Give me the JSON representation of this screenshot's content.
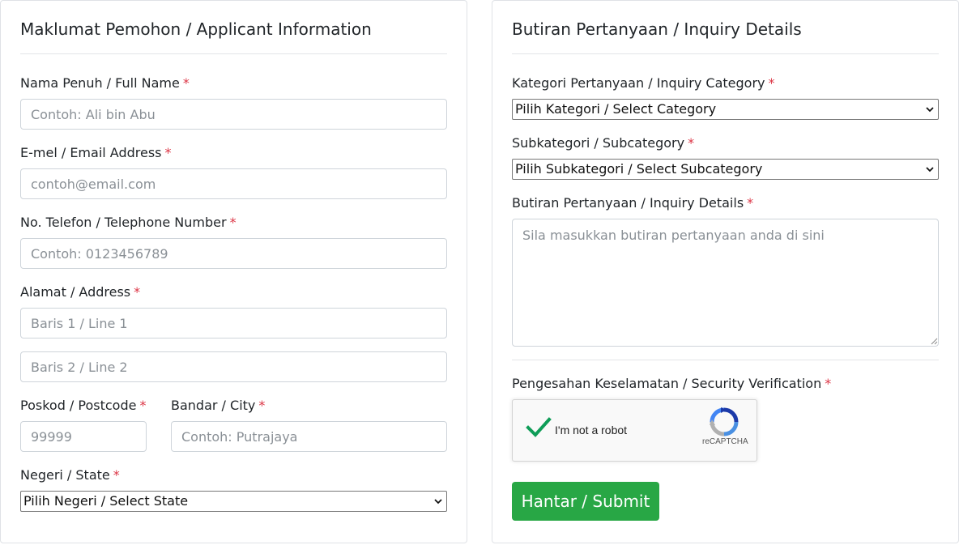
{
  "applicant": {
    "title": "Maklumat Pemohon / Applicant Information",
    "fullname": {
      "label": "Nama Penuh / Full Name",
      "required": "*",
      "placeholder": "Contoh: Ali bin Abu"
    },
    "email": {
      "label": "E-mel / Email Address",
      "required": "*",
      "placeholder": "contoh@email.com"
    },
    "phone": {
      "label": "No. Telefon / Telephone Number",
      "required": "*",
      "placeholder": "Contoh: 0123456789"
    },
    "address": {
      "label": "Alamat / Address",
      "required": "*",
      "line1_placeholder": "Baris 1 / Line 1",
      "line2_placeholder": "Baris 2 / Line 2"
    },
    "postcode": {
      "label": "Poskod / Postcode",
      "required": "*",
      "placeholder": "99999"
    },
    "city": {
      "label": "Bandar / City",
      "required": "*",
      "placeholder": "Contoh: Putrajaya"
    },
    "state": {
      "label": "Negeri / State",
      "required": "*",
      "selected": "Pilih Negeri / Select State"
    }
  },
  "inquiry": {
    "title": "Butiran Pertanyaan / Inquiry Details",
    "category": {
      "label": "Kategori Pertanyaan / Inquiry Category",
      "required": "*",
      "selected": "Pilih Kategori / Select Category"
    },
    "subcategory": {
      "label": "Subkategori / Subcategory",
      "required": "*",
      "selected": "Pilih Subkategori / Select Subcategory"
    },
    "details": {
      "label": "Butiran Pertanyaan / Inquiry Details",
      "required": "*",
      "placeholder": "Sila masukkan butiran pertanyaan anda di sini"
    },
    "verification": {
      "label": "Pengesahan Keselamatan / Security Verification",
      "required": "*"
    },
    "captcha": {
      "label": "I'm not a robot",
      "brand": "reCAPTCHA",
      "checked": true
    },
    "submit_label": "Hantar / Submit"
  },
  "icons": {
    "check": "checkmark-icon",
    "recaptcha": "recaptcha-logo-icon",
    "select": "chevron-down-icon",
    "resize": "resize-grip-icon"
  },
  "colors": {
    "required": "#dc3545",
    "submit": "#28a745",
    "check": "#0f9d58"
  }
}
